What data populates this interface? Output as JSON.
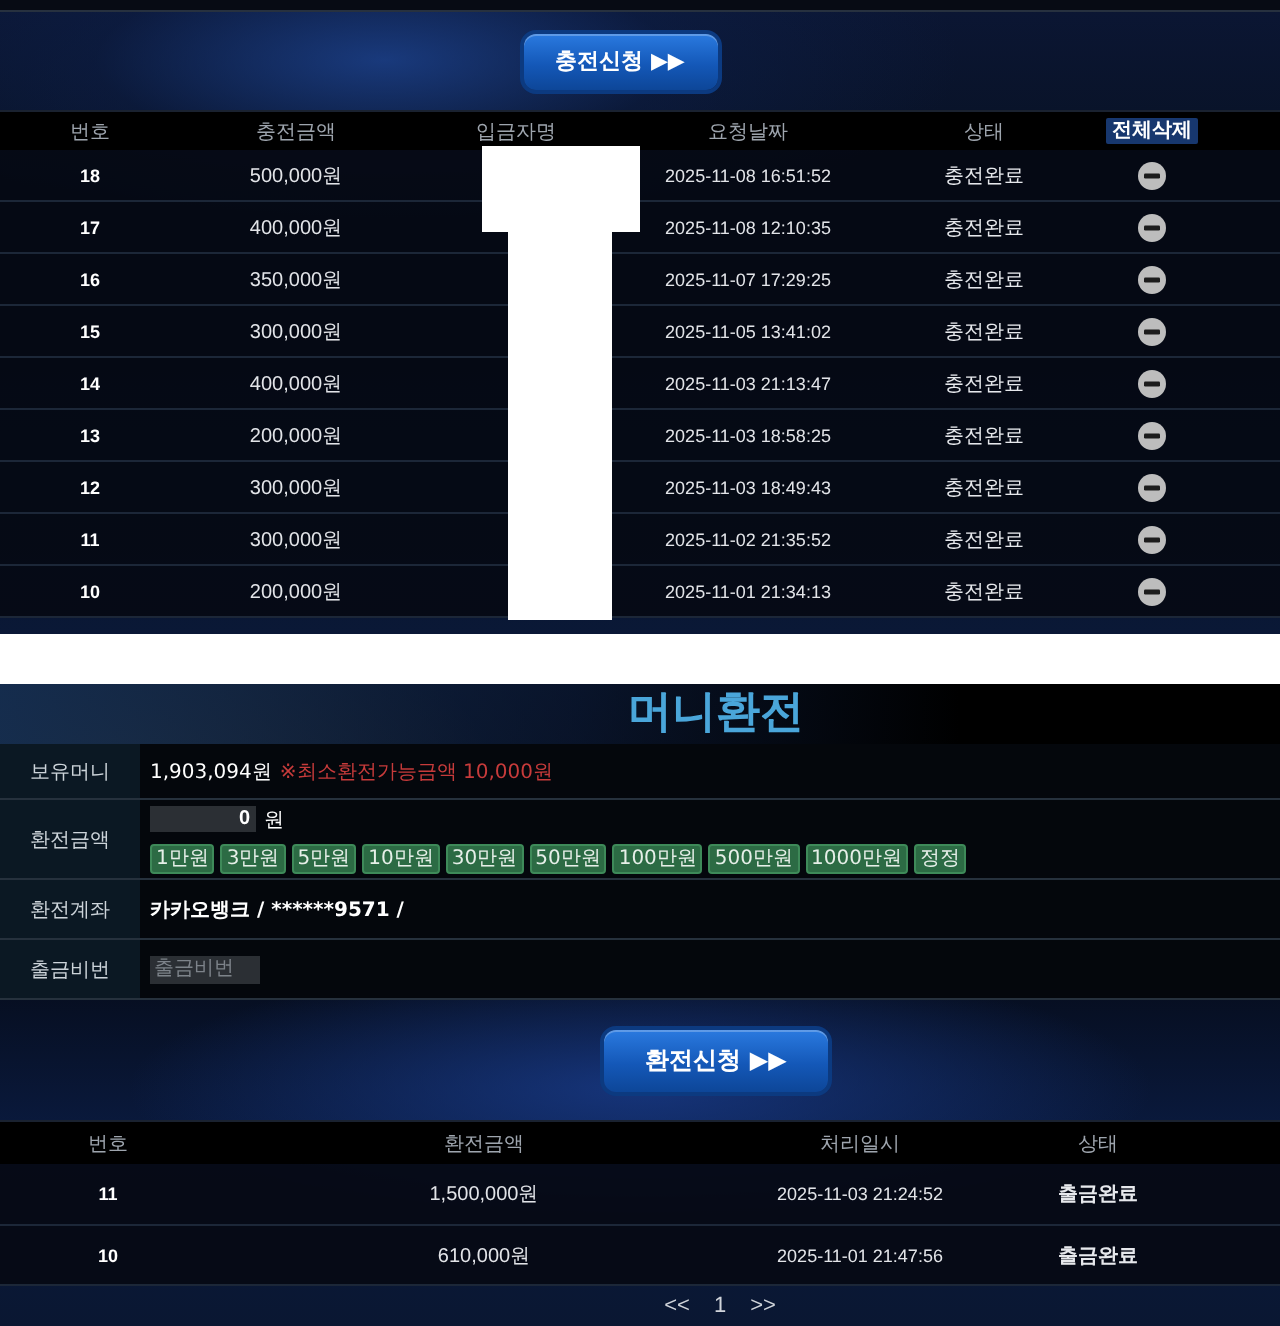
{
  "charge_request_button": "충전신청 ▶▶",
  "charge_table": {
    "columns": [
      "번호",
      "충전금액",
      "입금자명",
      "요청날짜",
      "상태"
    ],
    "delete_all_button": "전체삭제",
    "rows": [
      {
        "no": "18",
        "amount": "500,000원",
        "date": "2025-11-08 16:51:52",
        "status": "충전완료"
      },
      {
        "no": "17",
        "amount": "400,000원",
        "date": "2025-11-08 12:10:35",
        "status": "충전완료"
      },
      {
        "no": "16",
        "amount": "350,000원",
        "date": "2025-11-07 17:29:25",
        "status": "충전완료"
      },
      {
        "no": "15",
        "amount": "300,000원",
        "date": "2025-11-05 13:41:02",
        "status": "충전완료"
      },
      {
        "no": "14",
        "amount": "400,000원",
        "date": "2025-11-03 21:13:47",
        "status": "충전완료"
      },
      {
        "no": "13",
        "amount": "200,000원",
        "date": "2025-11-03 18:58:25",
        "status": "충전완료"
      },
      {
        "no": "12",
        "amount": "300,000원",
        "date": "2025-11-03 18:49:43",
        "status": "충전완료"
      },
      {
        "no": "11",
        "amount": "300,000원",
        "date": "2025-11-02 21:35:52",
        "status": "충전완료"
      },
      {
        "no": "10",
        "amount": "200,000원",
        "date": "2025-11-01 21:34:13",
        "status": "충전완료"
      }
    ]
  },
  "exchange": {
    "title": "머니환전",
    "fields": [
      {
        "kind": "balance",
        "label": "보유머니",
        "value": "1,903,094원",
        "note": "※최소환전가능금액 10,000원"
      },
      {
        "kind": "amount",
        "label": "환전금액",
        "value": "0",
        "unit": "원",
        "quick_buttons": [
          "1만원",
          "3만원",
          "5만원",
          "10만원",
          "30만원",
          "50만원",
          "100만원",
          "500만원",
          "1000만원",
          "정정"
        ]
      },
      {
        "kind": "account",
        "label": "환전계좌",
        "value": "카카오뱅크 / ******9571 /"
      },
      {
        "kind": "password",
        "label": "출금비번",
        "placeholder": "출금비번"
      }
    ],
    "submit_button": "환전신청 ▶▶"
  },
  "exchange_table": {
    "columns": [
      "번호",
      "환전금액",
      "처리일시",
      "상태"
    ],
    "rows": [
      {
        "no": "11",
        "amount": "1,500,000원",
        "date": "2025-11-03 21:24:52",
        "status": "출금완료"
      },
      {
        "no": "10",
        "amount": "610,000원",
        "date": "2025-11-01 21:47:56",
        "status": "출금완료"
      }
    ]
  },
  "pagination": {
    "prev": "<<",
    "pages": [
      "1"
    ],
    "next": ">>"
  }
}
